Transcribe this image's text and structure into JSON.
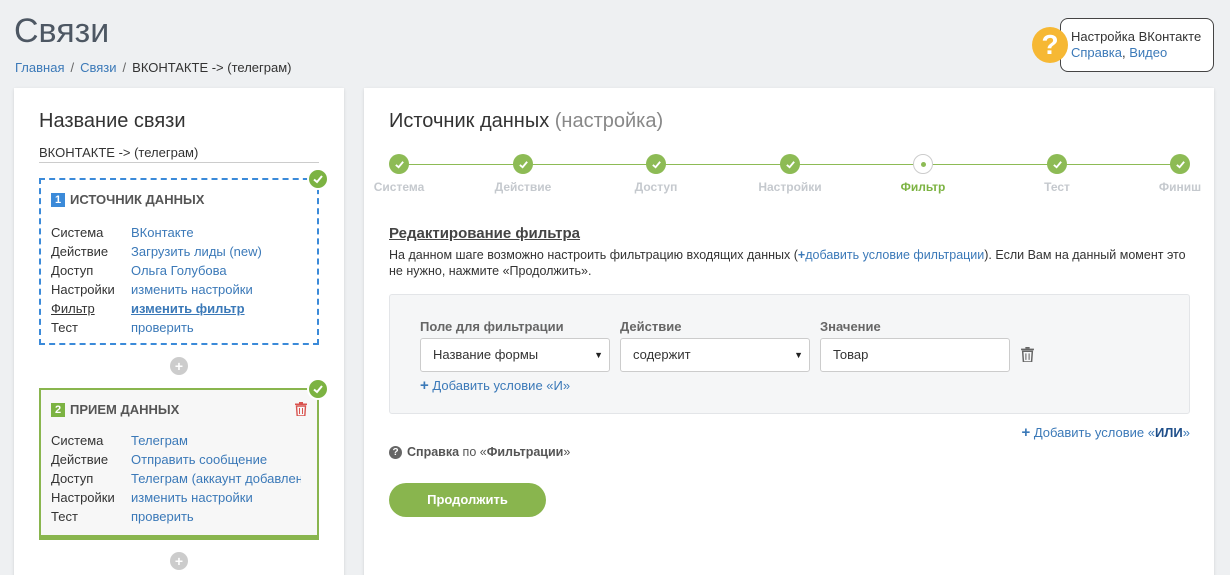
{
  "page": {
    "title": "Связи"
  },
  "breadcrumb": {
    "home": "Главная",
    "links": "Связи",
    "current": "ВКОНТАКТЕ -> (телеграм)"
  },
  "help_box": {
    "icon": "?",
    "title": "Настройка ВКонтакте",
    "link1": "Справка",
    "comma": ",",
    "link2": "Видео"
  },
  "left": {
    "title": "Название связи",
    "connection_name": "ВКОНТАКТЕ -> (телеграм)",
    "block1": {
      "num": "1",
      "title": "ИСТОЧНИК ДАННЫХ",
      "rows": [
        {
          "label": "Система",
          "value": "ВКонтакте"
        },
        {
          "label": "Действие",
          "value": "Загрузить лиды (new)"
        },
        {
          "label": "Доступ",
          "value": "Ольга Голубова"
        },
        {
          "label": "Настройки",
          "value": "изменить настройки"
        },
        {
          "label": "Фильтр",
          "value": "изменить фильтр"
        },
        {
          "label": "Тест",
          "value": "проверить"
        }
      ]
    },
    "block2": {
      "num": "2",
      "title": "ПРИЕМ ДАННЫХ",
      "rows": [
        {
          "label": "Система",
          "value": "Телеграм"
        },
        {
          "label": "Действие",
          "value": "Отправить сообщение"
        },
        {
          "label": "Доступ",
          "value": "Телеграм (аккаунт добавлен"
        },
        {
          "label": "Настройки",
          "value": "изменить настройки"
        },
        {
          "label": "Тест",
          "value": "проверить"
        }
      ]
    },
    "plus": "+"
  },
  "right": {
    "title": "Источник данных",
    "title_sub": "(настройка)",
    "steps": [
      "Система",
      "Действие",
      "Доступ",
      "Настройки",
      "Фильтр",
      "Тест",
      "Финиш"
    ],
    "active_step": "Фильтр",
    "edit_title": "Редактирование фильтра",
    "desc_part1": "На данном шаге возможно настроить фильтрацию входящих данных (",
    "desc_plus": "+",
    "desc_link": "добавить условие фильтрации",
    "desc_part2": "). Если Вам на данный момент это не нужно, нажмите «Продолжить».",
    "filter": {
      "col_field": "Поле для фильтрации",
      "col_action": "Действие",
      "col_value": "Значение",
      "field": "Название формы",
      "action": "содержит",
      "value": "Товар",
      "arrow": "▼",
      "add_and_plus": "+",
      "add_and": "Добавить условие «И»"
    },
    "add_or_plus": "+",
    "add_or_pre": "Добавить условие «",
    "add_or_key": "ИЛИ",
    "add_or_post": "»",
    "help_q": "?",
    "help_bold": "Справка",
    "help_mid": "по «",
    "help_bold2": "Фильтрации",
    "help_end": "»",
    "continue": "Продолжить"
  },
  "colors": {
    "green": "#89b54e",
    "blue": "#3b8ad9",
    "link": "#3b79b8",
    "help_yellow": "#f6b834",
    "trash_red": "#d9534f"
  }
}
